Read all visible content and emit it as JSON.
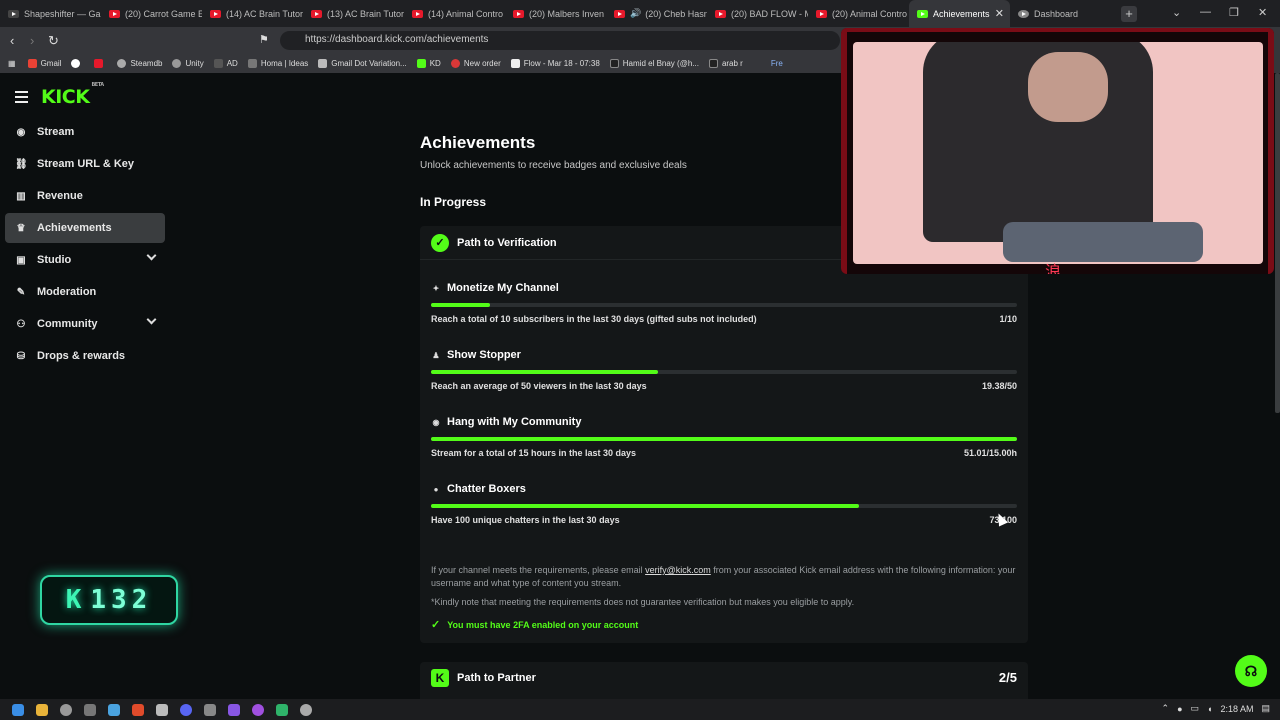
{
  "browser": {
    "tabs": [
      {
        "label": "Shapeshifter — Ga",
        "icon": "shapeshifter-icon"
      },
      {
        "label": "(20) Carrot Game E",
        "icon": "youtube-icon"
      },
      {
        "label": "(14) AC Brain Tutori",
        "icon": "youtube-icon"
      },
      {
        "label": "(13) AC Brain Tutori",
        "icon": "youtube-icon"
      },
      {
        "label": "(14) Animal Contro",
        "icon": "youtube-icon"
      },
      {
        "label": "(20) Malbers Inven",
        "icon": "youtube-icon"
      },
      {
        "label": "(20) Cheb Hasn",
        "icon": "youtube-icon"
      },
      {
        "label": "(20) BAD FLOW - M",
        "icon": "youtube-icon"
      },
      {
        "label": "(20) Animal Contro",
        "icon": "youtube-icon"
      },
      {
        "label": "Achievements",
        "icon": "kick-icon",
        "active": true
      },
      {
        "label": "Dashboard",
        "icon": "globe-icon"
      }
    ],
    "new_tab": "+",
    "url": "https://dashboard.kick.com/achievements",
    "bookmarks": [
      "Gmail",
      "Steamdb",
      "Unity",
      "AD",
      "Homa | Ideas",
      "Gmail Dot Variation...",
      "KD",
      "New order",
      "Flow - Mar 18 - 07:38",
      "Hamid el Bnay (@h...",
      "arab r"
    ],
    "bookmark_partial": "Fre"
  },
  "sidebar": {
    "logo": "KICK",
    "logo_tag": "BETA",
    "items": [
      {
        "label": "Stream",
        "icon": "stream-icon"
      },
      {
        "label": "Stream URL & Key",
        "icon": "link-icon"
      },
      {
        "label": "Revenue",
        "icon": "revenue-icon"
      },
      {
        "label": "Achievements",
        "icon": "trophy-icon",
        "active": true
      },
      {
        "label": "Studio",
        "icon": "studio-icon",
        "expandable": true
      },
      {
        "label": "Moderation",
        "icon": "wrench-icon"
      },
      {
        "label": "Community",
        "icon": "community-icon",
        "expandable": true
      },
      {
        "label": "Drops & rewards",
        "icon": "drops-icon"
      }
    ],
    "overlay_counter": "132"
  },
  "main": {
    "title": "Achievements",
    "subtitle": "Unlock achievements to receive badges and exclusive deals",
    "section": "In Progress",
    "verification": {
      "title": "Path to Verification",
      "achievements": [
        {
          "title": "Monetize My Channel",
          "icon": "sparkle-icon",
          "desc": "Reach a total of 10 subscribers in the last 30 days (gifted subs not included)",
          "value": "1/10",
          "progress": 0.1
        },
        {
          "title": "Show Stopper",
          "icon": "viewers-icon",
          "desc": "Reach an average of 50 viewers in the last 30 days",
          "value": "19.38/50",
          "progress": 0.3876
        },
        {
          "title": "Hang with My Community",
          "icon": "broadcast-icon",
          "desc": "Stream for a total of 15 hours in the last 30 days",
          "value": "51.01/15.00h",
          "progress": 1.0
        },
        {
          "title": "Chatter Boxers",
          "icon": "chat-icon",
          "desc": "Have 100 unique chatters in the last 30 days",
          "value": "73/100",
          "progress": 0.73
        }
      ],
      "note_prefix": "If your channel meets the requirements, please email ",
      "note_email": "verify@kick.com",
      "note_suffix": " from your associated Kick email address with the following information: your username and what type of content you stream.",
      "disclaimer": "*Kindly note that meeting the requirements does not guarantee verification but makes you eligible to apply.",
      "requirement": "You must have 2FA enabled on your account"
    },
    "partner": {
      "title": "Path to Partner",
      "value": "2/5"
    }
  },
  "webcam": {
    "overlay_glyph": "浪"
  },
  "taskbar": {
    "time": "2:18 AM"
  },
  "colors": {
    "accent": "#53fc18",
    "background": "#0b0e0f",
    "card": "#141718"
  }
}
